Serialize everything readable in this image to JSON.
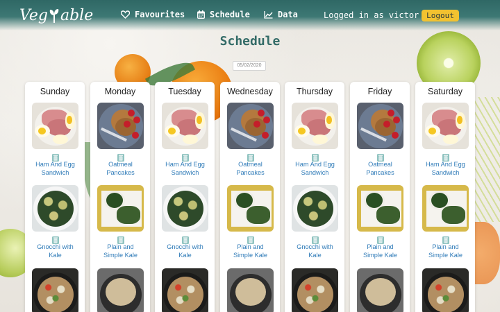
{
  "app": {
    "logo_left": "Veg",
    "logo_right": "able"
  },
  "nav": {
    "favourites": "Favourites",
    "schedule": "Schedule",
    "data": "Data"
  },
  "user": {
    "login_text": "Logged in as victor",
    "logout_label": "Logout"
  },
  "page": {
    "title": "Schedule",
    "date_value": "05/02/2020"
  },
  "days": [
    {
      "name": "Sunday",
      "meals": [
        "Ham And Egg Sandwich",
        "Gnocchi with Kale",
        ""
      ]
    },
    {
      "name": "Monday",
      "meals": [
        "Oatmeal Pancakes",
        "Plain and Simple Kale",
        ""
      ]
    },
    {
      "name": "Tuesday",
      "meals": [
        "Ham And Egg Sandwich",
        "Gnocchi with Kale",
        ""
      ]
    },
    {
      "name": "Wednesday",
      "meals": [
        "Oatmeal Pancakes",
        "Plain and Simple Kale",
        ""
      ]
    },
    {
      "name": "Thursday",
      "meals": [
        "Ham And Egg Sandwich",
        "Gnocchi with Kale",
        ""
      ]
    },
    {
      "name": "Friday",
      "meals": [
        "Oatmeal Pancakes",
        "Plain and Simple Kale",
        ""
      ]
    },
    {
      "name": "Saturday",
      "meals": [
        "Ham And Egg Sandwich",
        "Plain and Simple Kale",
        ""
      ]
    }
  ],
  "colors": {
    "header": "#3d7874",
    "title": "#336b67",
    "logout_bg": "#f2c230",
    "meal_link": "#2f7bb8",
    "trash_icon": "#8fc3c0"
  },
  "icons": {
    "favourites": "heart-icon",
    "schedule": "calendar-icon",
    "data": "line-chart-icon",
    "delete": "trash-icon"
  }
}
